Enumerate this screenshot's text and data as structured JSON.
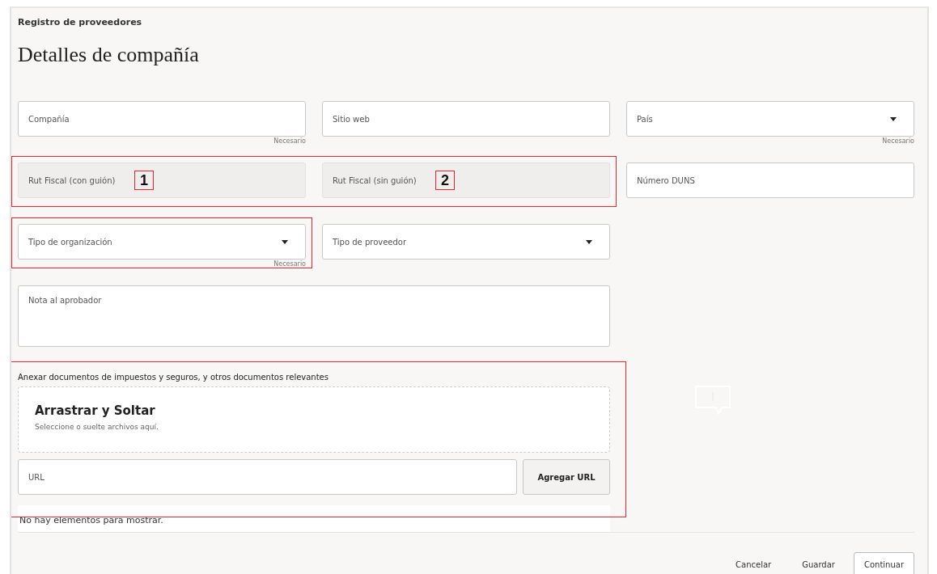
{
  "breadcrumb": "Registro de proveedores",
  "title": "Detalles de compañía",
  "rows": [
    {
      "groups": [
        {
          "highlighted": false,
          "fields": [
            {
              "kind": "text",
              "placeholder": "Compañía",
              "disabled": false,
              "hint": "Necesario"
            },
            {
              "kind": "text",
              "placeholder": "Sitio web",
              "disabled": false
            },
            {
              "kind": "select",
              "placeholder": "País",
              "disabled": false,
              "hint": "Necesario"
            }
          ]
        }
      ]
    },
    {
      "groups": [
        {
          "highlighted": true,
          "fields": [
            {
              "kind": "text",
              "placeholder": "Rut Fiscal (con guión)",
              "disabled": true,
              "marker": "1"
            },
            {
              "kind": "text",
              "placeholder": "Rut Fiscal (sin guión)",
              "disabled": true,
              "marker": "2"
            }
          ]
        },
        {
          "highlighted": false,
          "fields": [
            {
              "kind": "text",
              "placeholder": "Número DUNS",
              "disabled": false
            }
          ]
        }
      ]
    },
    {
      "groups": [
        {
          "highlighted": true,
          "fields": [
            {
              "kind": "select",
              "placeholder": "Tipo de organización",
              "disabled": false,
              "hint": "Necesario"
            }
          ]
        },
        {
          "highlighted": false,
          "fields": [
            {
              "kind": "select",
              "placeholder": "Tipo de proveedor",
              "disabled": false
            }
          ]
        }
      ]
    },
    {
      "groups": [
        {
          "highlighted": false,
          "fields": [
            {
              "kind": "textarea",
              "placeholder": "Nota al aprobador",
              "disabled": false
            }
          ]
        }
      ]
    }
  ],
  "attachments": {
    "highlighted": true,
    "label": "Anexar documentos de impuestos y seguros, y otros documentos relevantes",
    "drop_title": "Arrastrar y Soltar",
    "drop_subtitle": "Seleccione o suelte archivos aquí.",
    "url_placeholder": "URL",
    "add_button": "Agregar URL",
    "empty_message": "No hay elementos para mostrar."
  },
  "footer_buttons": [
    {
      "label": "Cancelar",
      "kind": "text"
    },
    {
      "label": "Guardar",
      "kind": "text"
    },
    {
      "label": "Continuar",
      "kind": "outlined"
    }
  ]
}
